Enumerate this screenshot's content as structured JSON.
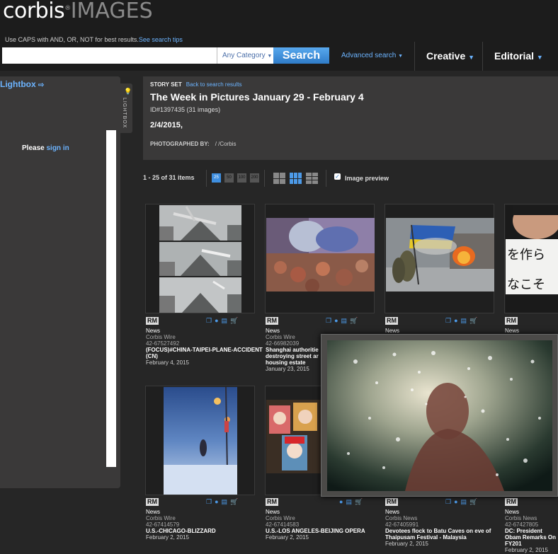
{
  "header": {
    "logo_main": "corbis",
    "logo_images": "IMAGES",
    "logo_mark": "®",
    "search_tip": "Use CAPS with AND, OR, NOT for best results.",
    "search_tip_link": "See search tips",
    "search_value": "",
    "category_label": "Any Category",
    "search_button": "Search",
    "advanced_search": "Advanced search",
    "nav": [
      {
        "label": "Creative"
      },
      {
        "label": "Editorial"
      }
    ]
  },
  "lightbox": {
    "title": "Lightbox",
    "tab_label": "LIGHTBOX",
    "please": "Please",
    "sign_in": "sign in"
  },
  "story": {
    "kicker": "STORY SET",
    "back_link": "Back to search results",
    "title": "The Week in Pictures January 29 - February 4",
    "id_line": "ID#1397435 (31 images)",
    "date": "2/4/2015,",
    "photographed_label": "PHOTOGRAPHED BY:",
    "photographer": "/ /Corbis"
  },
  "toolbar": {
    "count": "1 - 25 of 31 items",
    "page_sizes": [
      "25",
      "50",
      "100",
      "200"
    ],
    "active_page_size": "25",
    "image_preview_label": "Image preview",
    "image_preview_checked": true
  },
  "results": [
    {
      "license": "RM",
      "category": "News",
      "source": "Corbis Wire",
      "id": "42-67527492",
      "caption": "(FOCUS)#CHINA-TAIPEI-PLANE-ACCIDENT (CN)",
      "date": "February 4, 2015"
    },
    {
      "license": "RM",
      "category": "News",
      "source": "Corbis Wire",
      "id": "42-66982039",
      "caption": "Shanghai authoritie destroying street ar housing estate",
      "date": "January 23, 2015"
    },
    {
      "license": "RM",
      "category": "News",
      "source": "",
      "id": "",
      "caption": "",
      "date": ""
    },
    {
      "license": "RM",
      "category": "News",
      "source": "",
      "id": "",
      "caption": "",
      "date": ""
    },
    {
      "license": "RM",
      "category": "News",
      "source": "Corbis Wire",
      "id": "42-67414579",
      "caption": "U.S.-CHICAGO-BLIZZARD",
      "date": "February 2, 2015"
    },
    {
      "license": "RM",
      "category": "News",
      "source": "Corbis Wire",
      "id": "42-67414583",
      "caption": "U.S.-LOS ANGELES-BEIJING OPERA",
      "date": "February 2, 2015"
    },
    {
      "license": "RM",
      "category": "News",
      "source": "Corbis News",
      "id": "42-67405991",
      "caption": "Devotees flock to Batu Caves on eve of Thaipusam Festival - Malaysia",
      "date": "February 2, 2015"
    },
    {
      "license": "RM",
      "category": "News",
      "source": "Corbis News",
      "id": "42-67427805",
      "caption": "DC: President Obam Remarks On FY201",
      "date": "February 2, 2015"
    }
  ],
  "thumb4_text": "を作ら\nなこそ"
}
